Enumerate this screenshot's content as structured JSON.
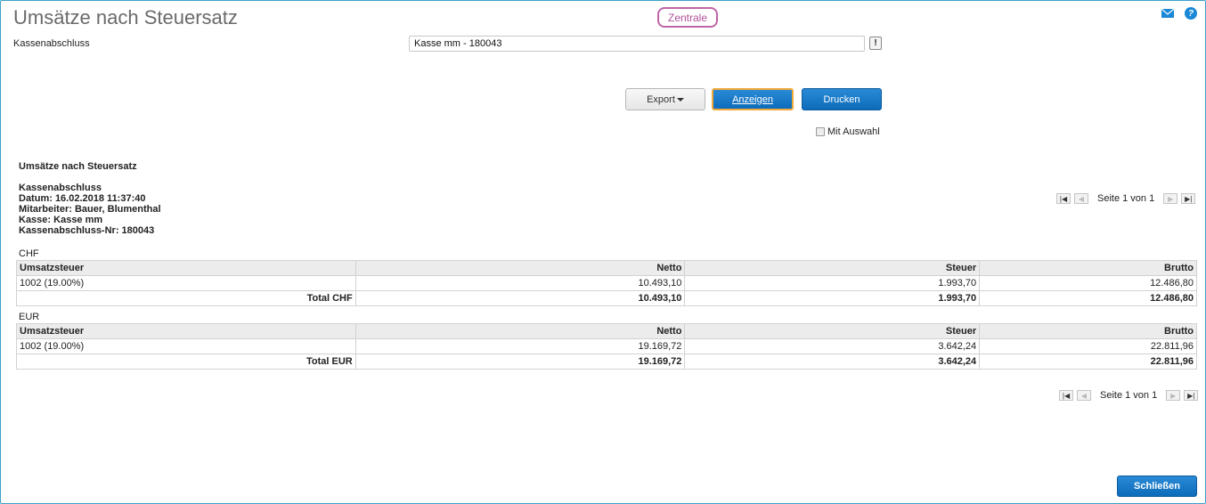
{
  "header": {
    "title": "Umsätze nach Steuersatz",
    "branch_badge": "Zentrale",
    "mail_icon": "mail-icon",
    "help_icon": "help-icon",
    "help_glyph": "?"
  },
  "filter": {
    "label": "Kassenabschluss",
    "value": "Kasse mm - 180043",
    "info_button": "!"
  },
  "toolbar": {
    "export_label": "Export",
    "show_label": "Anzeigen",
    "print_label": "Drucken",
    "with_selection_label": "Mit Auswahl"
  },
  "report": {
    "title": "Umsätze nach Steuersatz",
    "info": [
      "Kassenabschluss",
      "Datum: 16.02.2018 11:37:40",
      "Mitarbeiter: Bauer, Blumenthal",
      "Kasse: Kasse mm",
      "Kassenabschluss-Nr: 180043"
    ],
    "pager_text": "Seite 1 von 1",
    "columns": [
      "Umsatzsteuer",
      "Netto",
      "Steuer",
      "Brutto"
    ],
    "sections": [
      {
        "currency": "CHF",
        "rows": [
          {
            "rate": "1002 (19.00%)",
            "netto": "10.493,10",
            "steuer": "1.993,70",
            "brutto": "12.486,80"
          }
        ],
        "total": {
          "label": "Total CHF",
          "netto": "10.493,10",
          "steuer": "1.993,70",
          "brutto": "12.486,80"
        }
      },
      {
        "currency": "EUR",
        "rows": [
          {
            "rate": "1002 (19.00%)",
            "netto": "19.169,72",
            "steuer": "3.642,24",
            "brutto": "22.811,96"
          }
        ],
        "total": {
          "label": "Total EUR",
          "netto": "19.169,72",
          "steuer": "3.642,24",
          "brutto": "22.811,96"
        }
      }
    ]
  },
  "footer": {
    "close_label": "Schließen"
  },
  "colors": {
    "accent": "#0d6cba",
    "badge": "#c064a8",
    "focus": "#f0a93a"
  }
}
